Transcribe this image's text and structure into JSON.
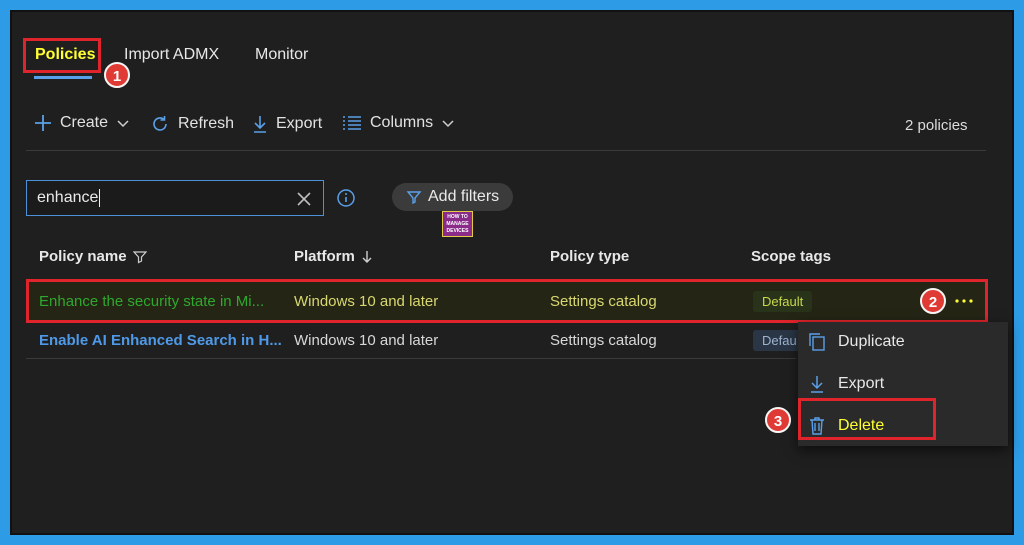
{
  "tabs": [
    {
      "label": "Policies",
      "active": true
    },
    {
      "label": "Import ADMX",
      "active": false
    },
    {
      "label": "Monitor",
      "active": false
    }
  ],
  "toolbar": {
    "create": "Create",
    "refresh": "Refresh",
    "export": "Export",
    "columns": "Columns",
    "count": "2 policies"
  },
  "search": {
    "value": "enhance"
  },
  "filters": {
    "add_label": "Add filters"
  },
  "logo": {
    "line1": "HOW TO",
    "line2": "MANAGE",
    "line3": "DEVICES"
  },
  "columns": {
    "name": "Policy name",
    "platform": "Platform",
    "type": "Policy type",
    "scope": "Scope tags"
  },
  "rows": [
    {
      "name": "Enhance the security state in Mi...",
      "platform": "Windows 10 and later",
      "type": "Settings catalog",
      "scope": "Default"
    },
    {
      "name": "Enable AI Enhanced Search in H...",
      "platform": "Windows 10 and later",
      "type": "Settings catalog",
      "scope": "Defau"
    }
  ],
  "context_menu": {
    "duplicate": "Duplicate",
    "export": "Export",
    "delete": "Delete"
  },
  "callouts": {
    "one": "1",
    "two": "2",
    "three": "3"
  },
  "colors": {
    "accent": "#4b90d8",
    "highlight": "#ffff33",
    "callout": "#e0242c",
    "page_bg": "#1f1f1f",
    "outer_bg": "#2e9be6"
  }
}
